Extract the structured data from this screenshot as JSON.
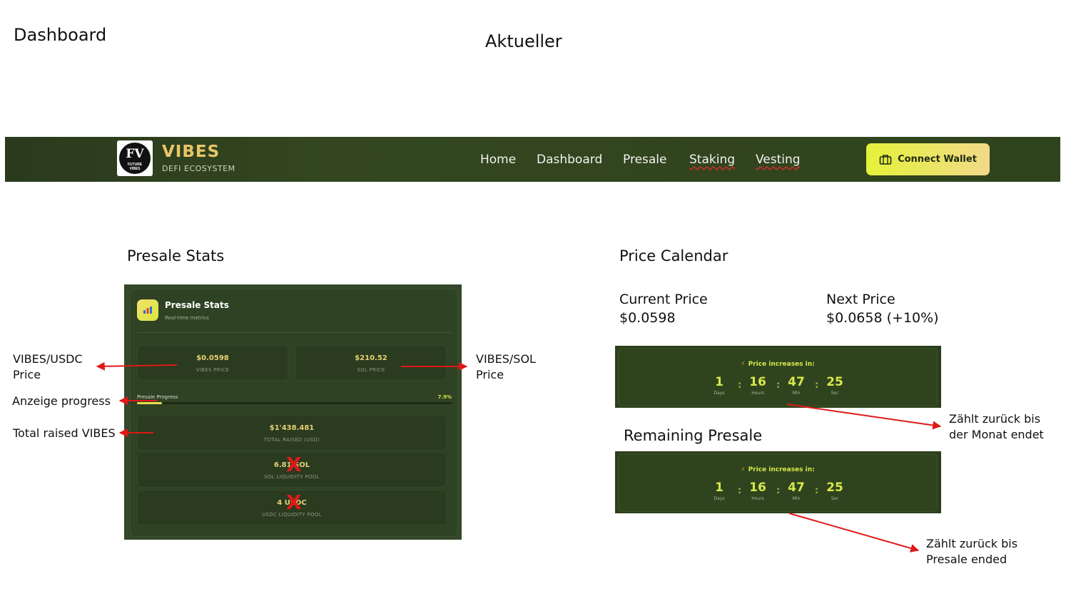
{
  "doc": {
    "title_left": "Dashboard",
    "title_center": "Aktueller"
  },
  "navbar": {
    "logo_mark": "FV",
    "logo_sub_line1": "FUTURE",
    "logo_sub_line2": "VIBES",
    "brand": "VIBES",
    "brand_sub": "DEFI ECOSYSTEM",
    "items": [
      {
        "label": "Home"
      },
      {
        "label": "Dashboard"
      },
      {
        "label": "Presale"
      },
      {
        "label": "Staking"
      },
      {
        "label": "Vesting"
      }
    ],
    "connect_label": "Connect Wallet"
  },
  "presale_stats": {
    "section_title": "Presale Stats",
    "panel_title": "Presale Stats",
    "panel_subtitle": "Real-time metrics",
    "vibes_price_value": "$0.0598",
    "vibes_price_label": "VIBES PRICE",
    "sol_price_value": "$210.52",
    "sol_price_label": "SOL PRICE",
    "progress_label": "Presale Progress",
    "progress_pct": "7.9%",
    "progress_fraction": 0.079,
    "total_raised_value": "$1'438.481",
    "total_raised_label": "TOTAL RAISED (USD)",
    "sol_pool_value": "6.81 SOL",
    "sol_pool_label": "SOL LIQUIDITY POOL",
    "usdc_pool_value": "4 USDC",
    "usdc_pool_label": "USDC LIQUIDITY POOL",
    "cross_mark": "X"
  },
  "annotations": {
    "vibes_usdc_1": "VIBES/USDC",
    "vibes_usdc_2": "Price",
    "vibes_sol_1": "VIBES/SOL",
    "vibes_sol_2": "Price",
    "progress": "Anzeige progress",
    "total_raised": "Total raised VIBES",
    "countdown1_1": "Zählt zurück bis",
    "countdown1_2": "der Monat endet",
    "countdown2_1": "Zählt zurück bis",
    "countdown2_2": "Presale ended"
  },
  "price_calendar": {
    "section_title": "Price Calendar",
    "current_label": "Current Price",
    "current_value": "$0.0598",
    "next_label": "Next Price",
    "next_value": "$0.0658 (+10%)"
  },
  "remaining": {
    "section_title": "Remaining Presale"
  },
  "countdowns": [
    {
      "heading": "Price increases in:",
      "bolt_icon": "⚡",
      "units": [
        {
          "value": "1",
          "label": "Days"
        },
        {
          "value": "16",
          "label": "Hours"
        },
        {
          "value": "47",
          "label": "Min"
        },
        {
          "value": "25",
          "label": "Sec"
        }
      ]
    },
    {
      "heading": "Price increases in:",
      "bolt_icon": "⚡",
      "units": [
        {
          "value": "1",
          "label": "Days"
        },
        {
          "value": "16",
          "label": "Hours"
        },
        {
          "value": "47",
          "label": "Min"
        },
        {
          "value": "25",
          "label": "Sec"
        }
      ]
    }
  ],
  "colors": {
    "annotation_red": "#e01818",
    "accent_lime": "#d8e84a",
    "panel_green": "#2f4224"
  }
}
